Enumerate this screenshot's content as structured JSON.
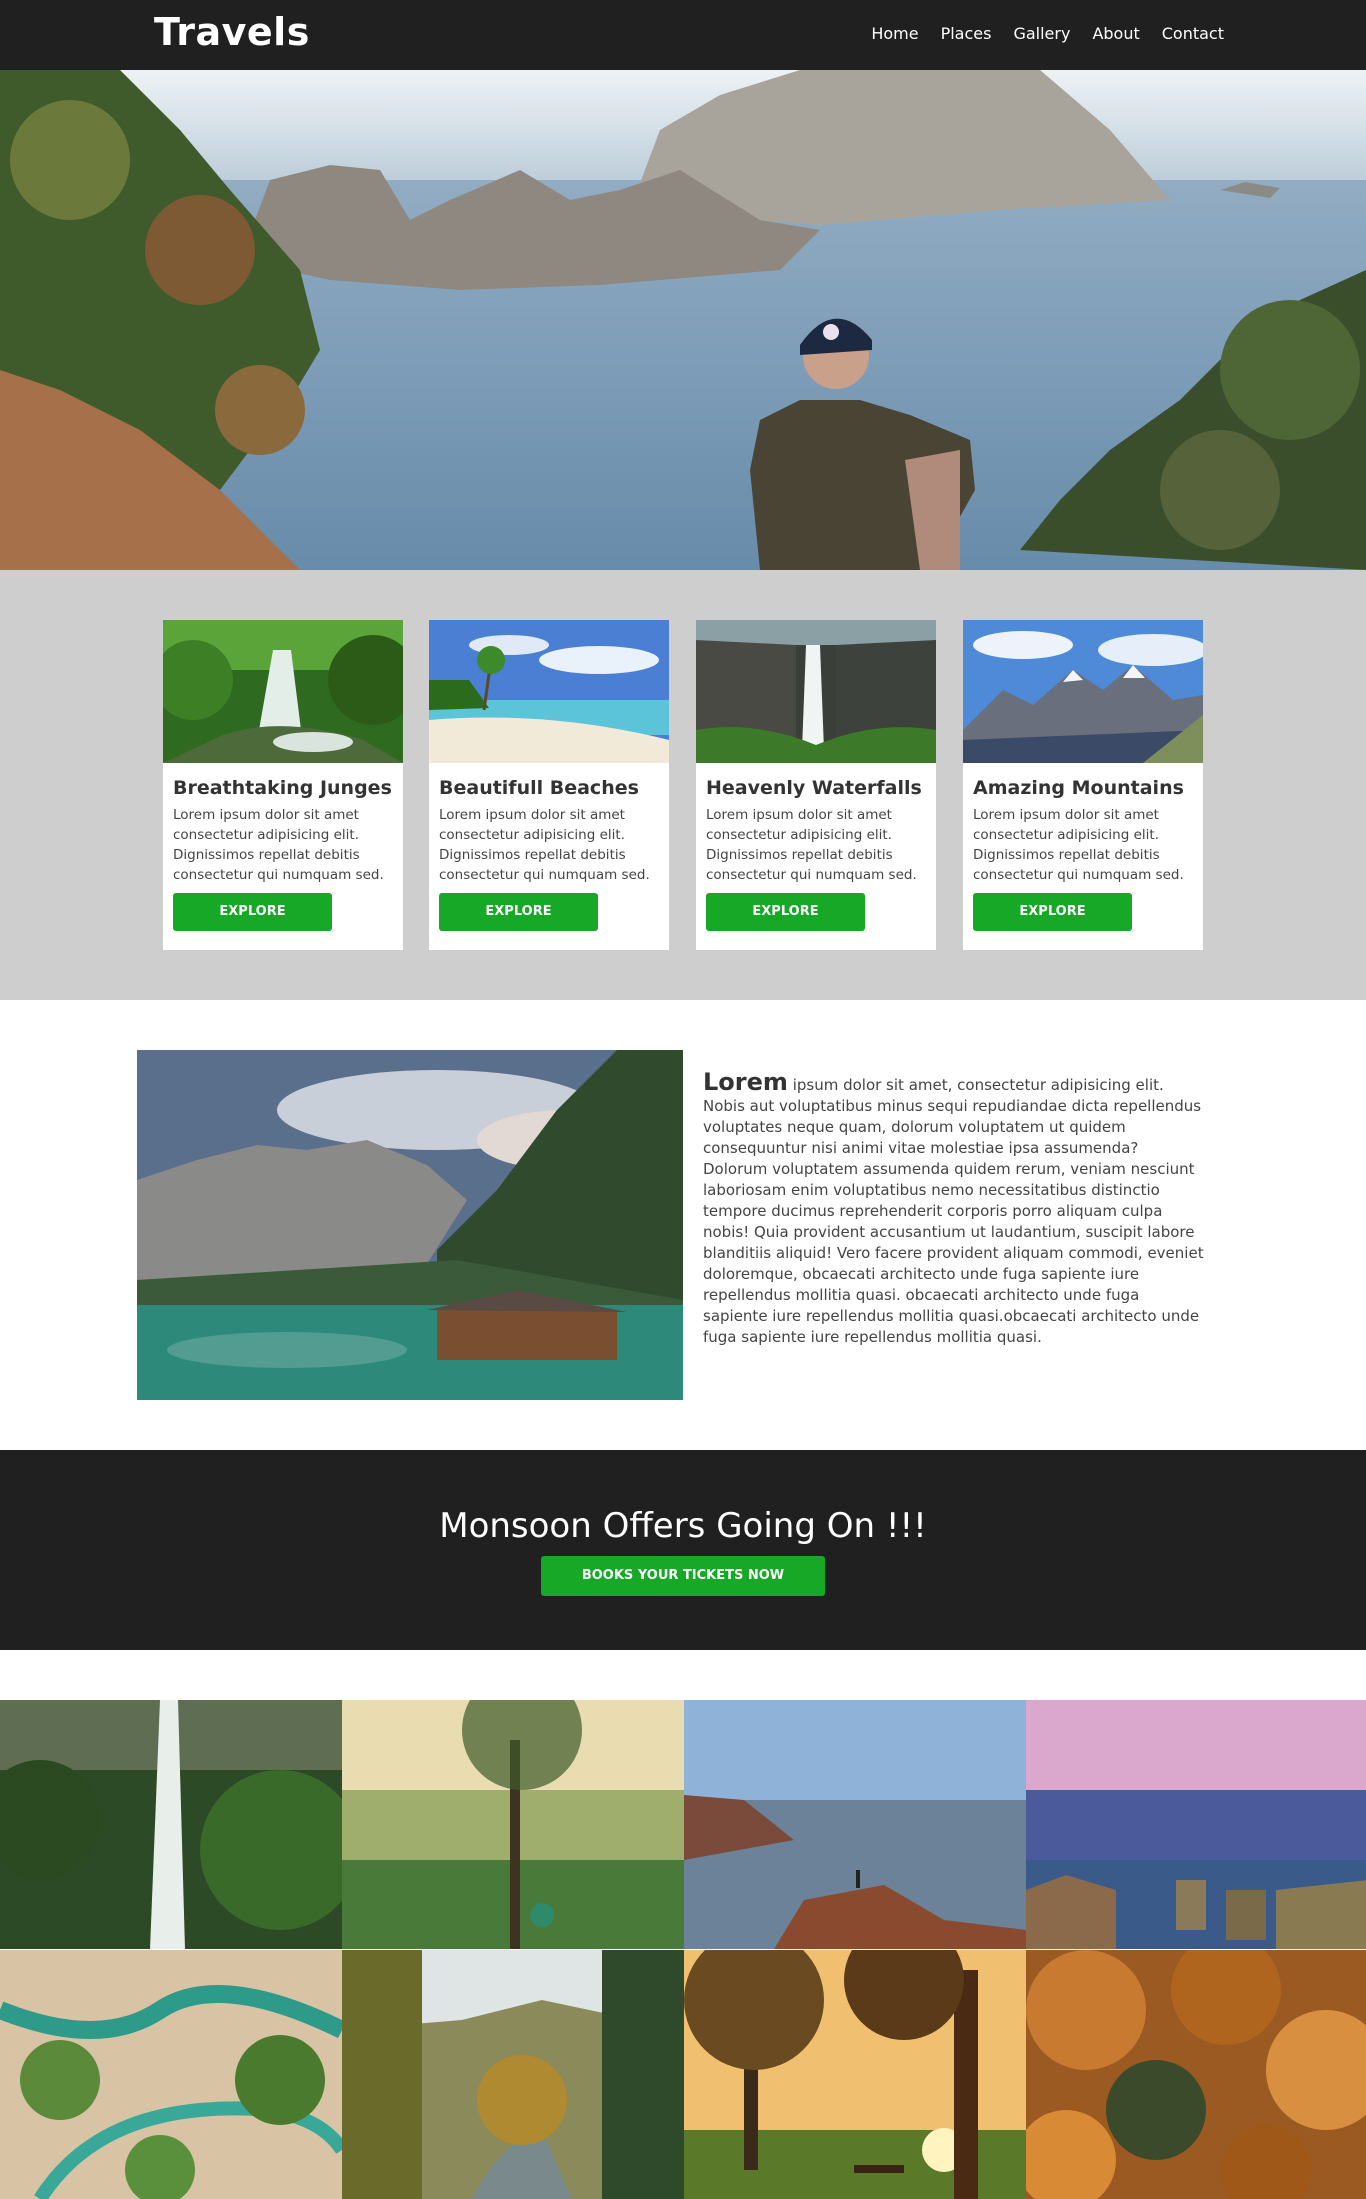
{
  "nav": {
    "brand": "Travels",
    "links": [
      "Home",
      "Places",
      "Gallery",
      "About",
      "Contact"
    ]
  },
  "hero": {
    "image": "man-sitting-overlooking-sea-and-rocky-islands"
  },
  "cards": [
    {
      "title": "Breathtaking Junges",
      "text": "Lorem ipsum dolor sit amet consectetur adipisicing elit. Dignissimos repellat debitis consectetur qui numquam sed.",
      "button": "EXPLORE",
      "image": "jungle-stream"
    },
    {
      "title": "Beautifull Beaches",
      "text": "Lorem ipsum dolor sit amet consectetur adipisicing elit. Dignissimos repellat debitis consectetur qui numquam sed.",
      "button": "EXPLORE",
      "image": "tropical-beach"
    },
    {
      "title": "Heavenly Waterfalls",
      "text": "Lorem ipsum dolor sit amet consectetur adipisicing elit. Dignissimos repellat debitis consectetur qui numquam sed.",
      "button": "EXPLORE",
      "image": "waterfall-cliffs"
    },
    {
      "title": "Amazing Mountains",
      "text": "Lorem ipsum dolor sit amet consectetur adipisicing elit. Dignissimos repellat debitis consectetur qui numquam sed.",
      "button": "EXPLORE",
      "image": "snowy-mountains"
    }
  ],
  "about": {
    "lead": "Lorem",
    "text": "ipsum dolor sit amet, consectetur adipisicing elit. Nobis aut voluptatibus minus sequi repudiandae dicta repellendus voluptates neque quam, dolorum voluptatem ut quidem consequuntur nisi animi vitae molestiae ipsa assumenda? Dolorum voluptatem assumenda quidem rerum, veniam nesciunt laboriosam enim voluptatibus nemo necessitatibus distinctio tempore ducimus reprehenderit corporis porro aliquam culpa nobis! Quia provident accusantium ut laudantium, suscipit labore blanditiis aliquid! Vero facere provident aliquam commodi, eveniet doloremque, obcaecati architecto unde fuga sapiente iure repellendus mollitia quasi. obcaecati architecto unde fuga sapiente iure repellendus mollitia quasi.obcaecati architecto unde fuga sapiente iure repellendus mollitia quasi.",
    "image": "mountain-lake-cabin"
  },
  "offer": {
    "title": "Monsoon Offers Going On !!!",
    "button": "BOOKS YOUR TICKETS NOW"
  },
  "gallery": [
    "waterfall-forest",
    "man-under-tree-valley",
    "cliff-at-sunset",
    "sea-stacks-purple-sky",
    "aerial-river-delta",
    "autumn-forest-stream",
    "sunset-park-trees",
    "autumn-hills-aerial"
  ],
  "colors": {
    "nav_bg": "#202020",
    "accent_green": "#16a826",
    "cards_bg": "#cecece"
  }
}
